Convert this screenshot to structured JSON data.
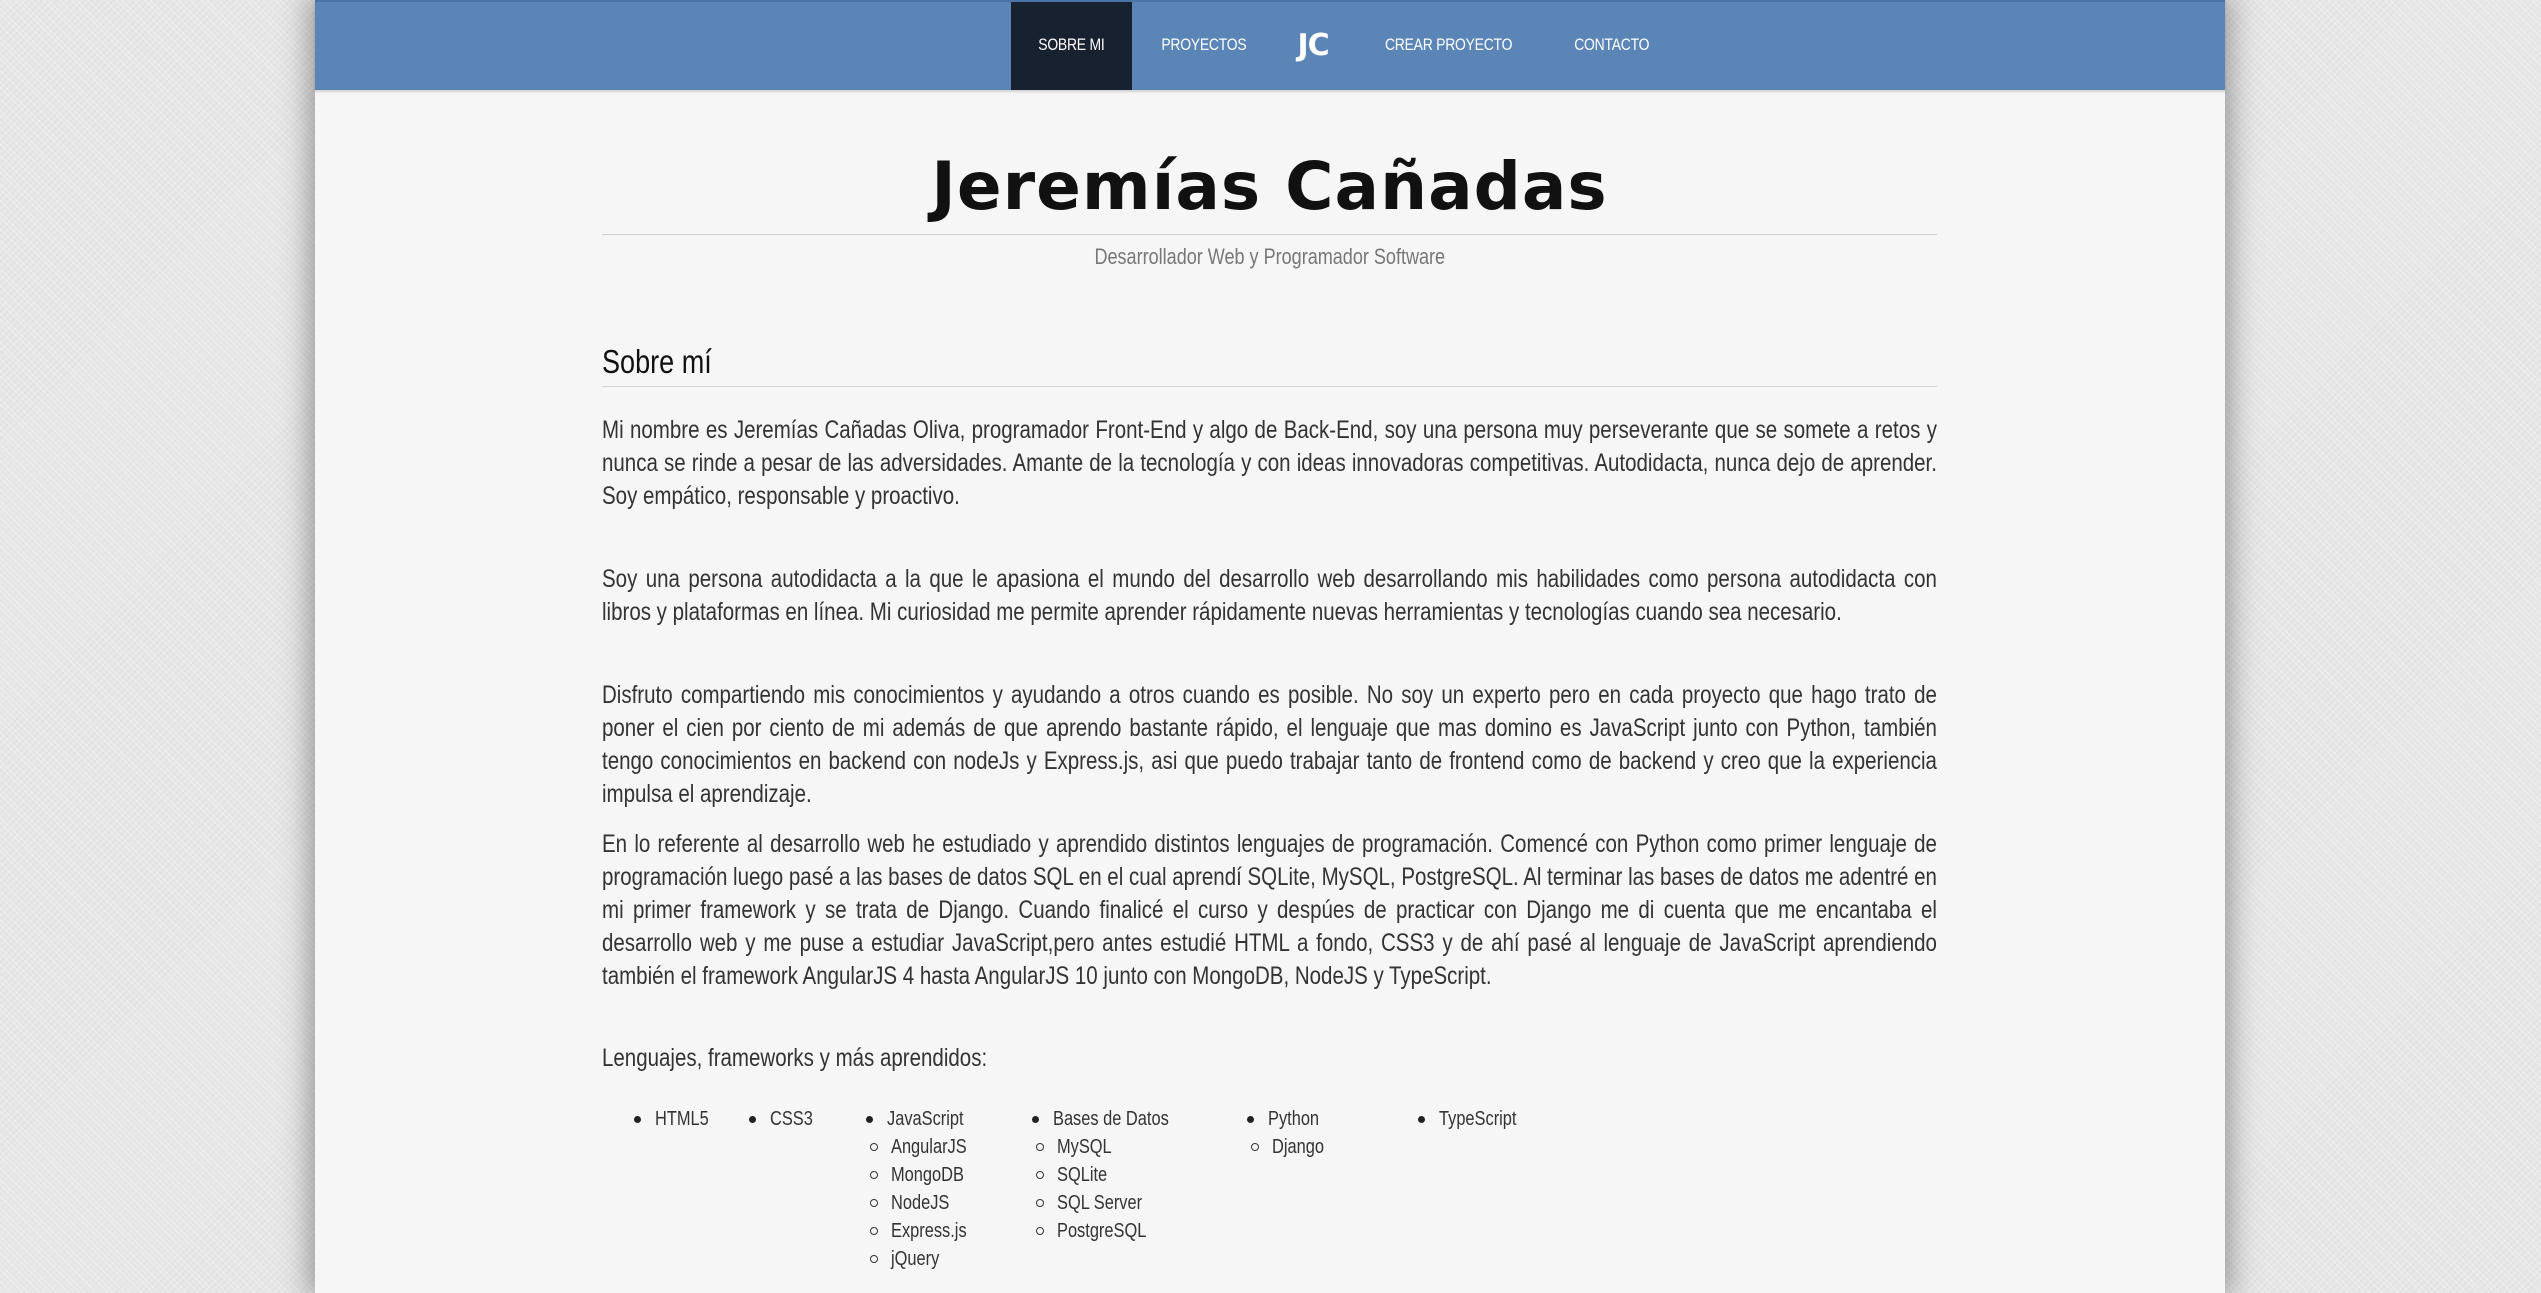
{
  "nav": {
    "items": [
      {
        "label": "SOBRE MI",
        "active": true
      },
      {
        "label": "PROYECTOS",
        "active": false
      },
      {
        "label": "JC",
        "logo": true
      },
      {
        "label": "CREAR PROYECTO",
        "active": false
      },
      {
        "label": "CONTACTO",
        "active": false
      }
    ],
    "bar_color": "#5b84b7",
    "active_color": "#172130"
  },
  "header": {
    "title": "Jeremías Cañadas",
    "subtitle": "Desarrollador Web y Programador Software"
  },
  "about": {
    "heading": "Sobre mí",
    "paragraphs": [
      "Mi nombre es Jeremías Cañadas Oliva, programador Front-End y algo de Back-End, soy una persona muy perseverante que se somete a retos y nunca se rinde a pesar de las adversidades. Amante de la tecnología y con ideas innovadoras competitivas. Autodidacta, nunca dejo de aprender. Soy empático, responsable y proactivo.",
      "Soy una persona autodidacta a la que le apasiona el mundo del desarrollo web desarrollando mis habilidades como persona autodidacta con libros y plataformas en línea. Mi curiosidad me permite aprender rápidamente nuevas herramientas y tecnologías cuando sea necesario.",
      "Disfruto compartiendo mis conocimientos y ayudando a otros cuando es posible. No soy un experto pero en cada proyecto que hago trato de poner el cien por ciento de mi además de que aprendo bastante rápido, el lenguaje que mas domino es JavaScript junto con Python, también tengo conocimientos en backend con nodeJs y Express.js, asi que puedo trabajar tanto de frontend como de backend y creo que la experiencia impulsa el aprendizaje.",
      "En lo referente al desarrollo web he estudiado y aprendido distintos lenguajes de programación. Comencé con Python como primer lenguaje de programación luego pasé a las bases de datos SQL en el cual aprendí SQLite, MySQL, PostgreSQL. Al terminar las bases de datos me adentré en mi primer framework y se trata de Django. Cuando finalicé el curso y despúes de practicar con Django me di cuenta que me encantaba el desarrollo web y me puse a estudiar JavaScript,pero antes estudié HTML a fondo, CSS3 y de ahí pasé al lenguaje de JavaScript aprendiendo también el framework AngularJS 4 hasta AngularJS 10 junto con MongoDB, NodeJS y TypeScript."
    ],
    "skills_intro": "Lenguajes, frameworks y más aprendidos:",
    "skills": [
      {
        "name": "HTML5",
        "children": []
      },
      {
        "name": "CSS3",
        "children": []
      },
      {
        "name": "JavaScript",
        "children": [
          "AngularJS",
          "MongoDB",
          "NodeJS",
          "Express.js",
          "jQuery"
        ]
      },
      {
        "name": "Bases de Datos",
        "children": [
          "MySQL",
          "SQLite",
          "SQL Server",
          "PostgreSQL"
        ]
      },
      {
        "name": "Python",
        "children": [
          "Django"
        ]
      },
      {
        "name": "TypeScript",
        "children": []
      }
    ]
  }
}
